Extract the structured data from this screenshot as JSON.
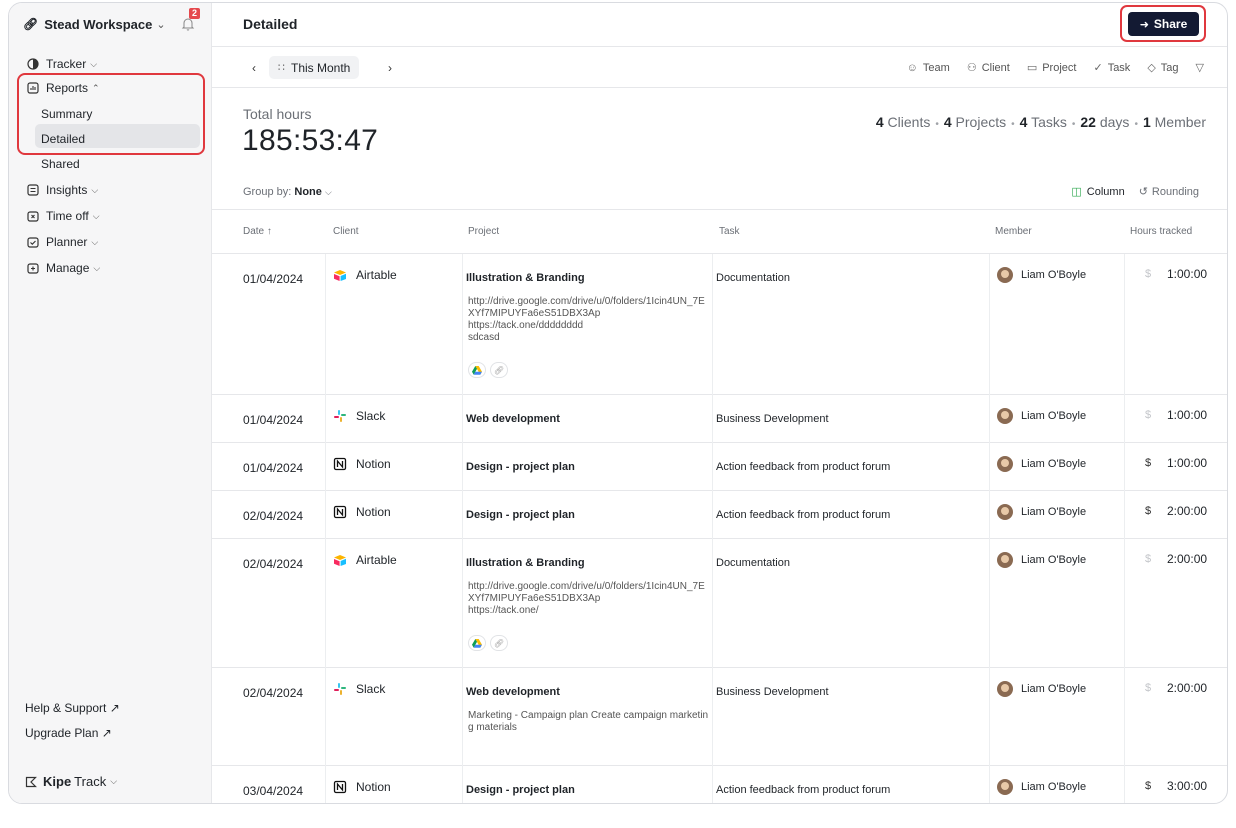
{
  "workspace": {
    "name": "Stead Workspace",
    "notifications": "2"
  },
  "sidebar": {
    "tracker": "Tracker",
    "reports": "Reports",
    "report_items": [
      "Summary",
      "Detailed",
      "Shared"
    ],
    "insights": "Insights",
    "time_off": "Time off",
    "planner": "Planner",
    "manage": "Manage",
    "help": "Help & Support",
    "upgrade": "Upgrade Plan",
    "brand_bold": "Kipe",
    "brand_rest": "Track"
  },
  "header": {
    "title": "Detailed",
    "share_label": "Share"
  },
  "filterbar": {
    "period": "This Month",
    "filters": [
      "Team",
      "Client",
      "Project",
      "Task",
      "Tag"
    ]
  },
  "totals": {
    "label": "Total hours",
    "value": "185:53:47",
    "clients_count": "4",
    "clients_label": "Clients",
    "projects_count": "4",
    "projects_label": "Projects",
    "tasks_count": "4",
    "tasks_label": "Tasks",
    "days_count": "22",
    "days_label": "days",
    "members_count": "1",
    "members_label": "Member"
  },
  "toolbar": {
    "group_by_label": "Group by:",
    "group_by_value": "None",
    "column_label": "Column",
    "rounding_label": "Rounding"
  },
  "table": {
    "columns": [
      "Date",
      "Client",
      "Project",
      "Task",
      "Member",
      "Hours tracked"
    ],
    "rows": [
      {
        "date": "01/04/2024",
        "client": "Airtable",
        "project": "Illustration & Branding",
        "note": "http://drive.google.com/drive/u/0/folders/1Icin4UN_7EXYf7MIPUYFa6eS51DBX3Ap\nhttps://tack.one/dddddddd\nsdcasd",
        "task": "Documentation",
        "member": "Liam O'Boyle",
        "hours": "1:00:00"
      },
      {
        "date": "01/04/2024",
        "client": "Slack",
        "project": "Web development",
        "note": "",
        "task": "Business Development",
        "member": "Liam O'Boyle",
        "hours": "1:00:00"
      },
      {
        "date": "01/04/2024",
        "client": "Notion",
        "project": "Design - project plan",
        "note": "",
        "task": "Action feedback from product forum",
        "member": "Liam O'Boyle",
        "hours": "1:00:00"
      },
      {
        "date": "02/04/2024",
        "client": "Notion",
        "project": "Design - project plan",
        "note": "",
        "task": "Action feedback from product forum",
        "member": "Liam O'Boyle",
        "hours": "2:00:00"
      },
      {
        "date": "02/04/2024",
        "client": "Airtable",
        "project": "Illustration & Branding",
        "note": "http://drive.google.com/drive/u/0/folders/1Icin4UN_7EXYf7MIPUYFa6eS51DBX3Ap\nhttps://tack.one/",
        "task": "Documentation",
        "member": "Liam O'Boyle",
        "hours": "2:00:00"
      },
      {
        "date": "02/04/2024",
        "client": "Slack",
        "project": "Web development",
        "note": "Marketing - Campaign plan Create campaign marketing materials",
        "task": "Business Development",
        "member": "Liam O'Boyle",
        "hours": "2:00:00"
      },
      {
        "date": "03/04/2024",
        "client": "Notion",
        "project": "Design - project plan",
        "note": "",
        "task": "Action feedback from product forum",
        "member": "Liam O'Boyle",
        "hours": "3:00:00"
      }
    ],
    "currency_symbol": "$"
  }
}
